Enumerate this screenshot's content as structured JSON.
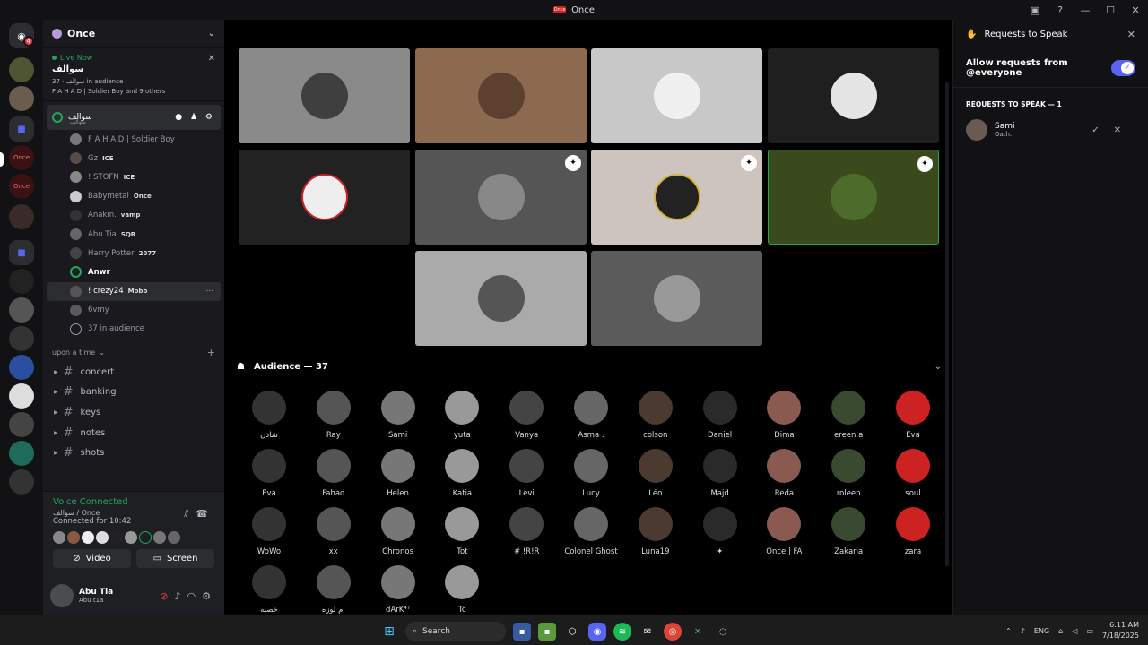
{
  "window": {
    "title": "Once",
    "logo_text": "Once"
  },
  "guild": {
    "name": "Once"
  },
  "live": {
    "status": "Live Now",
    "title": "سوالف",
    "audience_line": "سوالف · 37 in audience",
    "speakers_line": "F A H A D | Soldier Boy and 9 others"
  },
  "stage_channel": {
    "name": "سوالف",
    "sub": "سوالف"
  },
  "members": [
    {
      "name": "F A H A D | Soldier Boy",
      "tag": ""
    },
    {
      "name": "Gz",
      "tag": "ICE"
    },
    {
      "name": "! STOFN",
      "tag": "ICE"
    },
    {
      "name": "Babymetal",
      "tag": "Once"
    },
    {
      "name": "Anakin.",
      "tag": "vamp"
    },
    {
      "name": "Abu Tia",
      "tag": "SQR"
    },
    {
      "name": "Harry Potter",
      "tag": "2077"
    },
    {
      "name": "Anwr",
      "tag": ""
    },
    {
      "name": "! crezy24",
      "tag": "Mobb"
    },
    {
      "name": "6vmy",
      "tag": ""
    },
    {
      "name": "37 in audience",
      "tag": ""
    }
  ],
  "category": {
    "name": "upon a time"
  },
  "text_channels": [
    "concert",
    "banking",
    "keys",
    "notes",
    "shots"
  ],
  "voice": {
    "status": "Voice Connected",
    "channel": "سوالف / Once",
    "time": "Connected for 10:42",
    "video_label": "Video",
    "screen_label": "Screen"
  },
  "user": {
    "name": "Abu Tia",
    "status": "Abu t1a"
  },
  "audience": {
    "header": "Audience — 37",
    "people": [
      "شاذن",
      "Ray",
      "Sami",
      "yuta",
      "Vanya",
      "Asma .",
      "colson",
      "Daniel",
      "Dima",
      "ereen.a",
      "Eva",
      "Eva",
      "Fahad",
      "Helen",
      "Katia",
      "Levi",
      "Lucy",
      "Léo",
      "Majd",
      "Reda",
      "roleen",
      "soul",
      "WoWo",
      "xx",
      "Chronos",
      "Tot",
      "# !R!R",
      "Colonel Ghost",
      "Luna19",
      "✦",
      "Once | FA",
      "Zakaria",
      "zara",
      "خصبه",
      "ام لوزه",
      "dArK⁴⁷",
      "Tc"
    ]
  },
  "requests": {
    "title": "Requests to Speak",
    "allow_label": "Allow requests from @everyone",
    "section": "REQUESTS TO SPEAK — 1",
    "items": [
      {
        "name": "Sami",
        "sub": "Oath."
      }
    ]
  },
  "taskbar": {
    "search": "Search",
    "lang": "ENG",
    "time": "6:11 AM",
    "date": "7/18/2025"
  },
  "colors": {
    "accent": "#5865f2",
    "online": "#23a55a",
    "danger": "#f23f43"
  }
}
